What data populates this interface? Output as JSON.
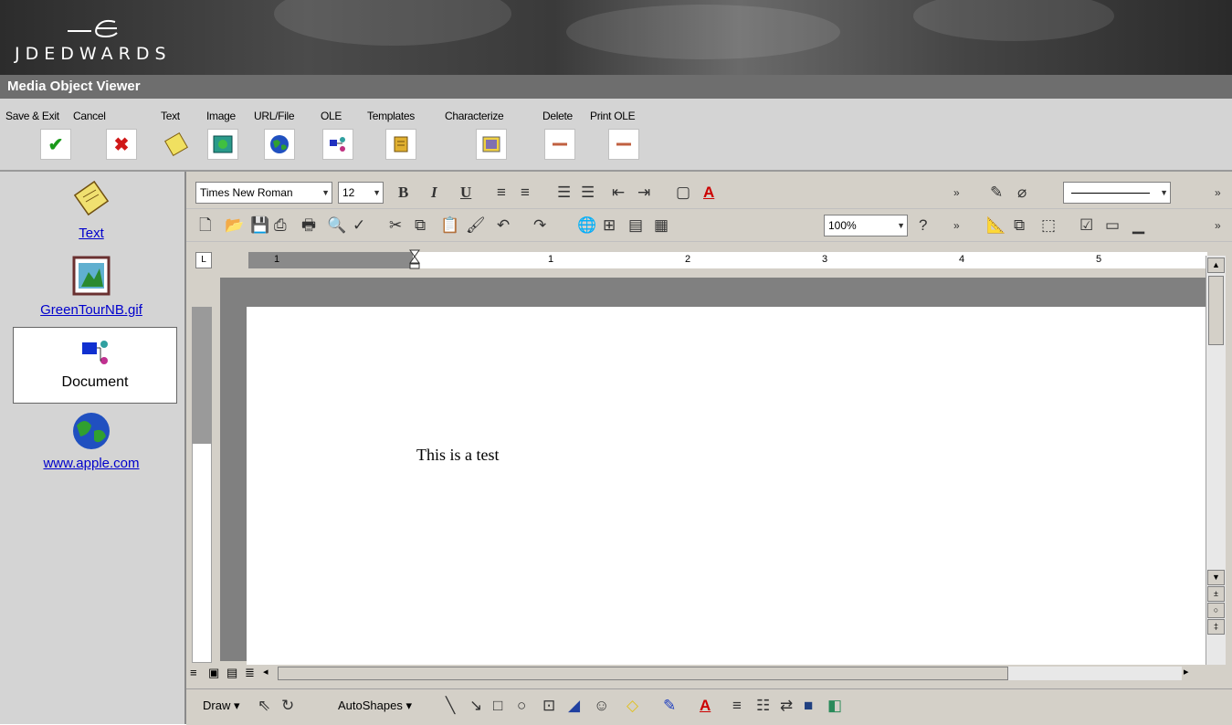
{
  "brand": {
    "name": "JDEDWARDS"
  },
  "window": {
    "title": "Media Object Viewer"
  },
  "toolbar": {
    "buttons": [
      {
        "label": "Save & Exit",
        "icon": "check-icon",
        "color": "#1a9a1a"
      },
      {
        "label": "Cancel",
        "icon": "x-icon",
        "color": "#d01818"
      },
      {
        "label": "Text",
        "icon": "note-icon",
        "color": "#e8d040"
      },
      {
        "label": "Image",
        "icon": "picture-icon",
        "color": "#2a8a8a"
      },
      {
        "label": "URL/File",
        "icon": "globe-icon",
        "color": "#2050c0"
      },
      {
        "label": "OLE",
        "icon": "ole-icon",
        "color": "#2030c0"
      },
      {
        "label": "Templates",
        "icon": "template-icon",
        "color": "#e0b030"
      },
      {
        "label": "Characterize",
        "icon": "characterize-icon",
        "color": "#8070b0"
      },
      {
        "label": "Delete",
        "icon": "delete-icon",
        "color": "#c06040"
      },
      {
        "label": "Print OLE",
        "icon": "print-ole-icon",
        "color": "#c06040"
      }
    ]
  },
  "sidebar": {
    "items": [
      {
        "label": "Text",
        "link": true,
        "icon": "note-icon"
      },
      {
        "label": "GreenTourNB.gif",
        "link": true,
        "icon": "picture-icon"
      },
      {
        "label": "Document",
        "link": false,
        "selected": true,
        "icon": "ole-icon"
      },
      {
        "label": "www.apple.com",
        "link": true,
        "icon": "globe-icon"
      }
    ]
  },
  "word": {
    "font_name": "Times New Roman",
    "font_size": "12",
    "zoom": "100%",
    "ruler_marks": [
      "1",
      "1",
      "2",
      "3",
      "4",
      "5"
    ],
    "document_text": "This is a test",
    "draw_label": "Draw",
    "autoshapes_label": "AutoShapes"
  }
}
